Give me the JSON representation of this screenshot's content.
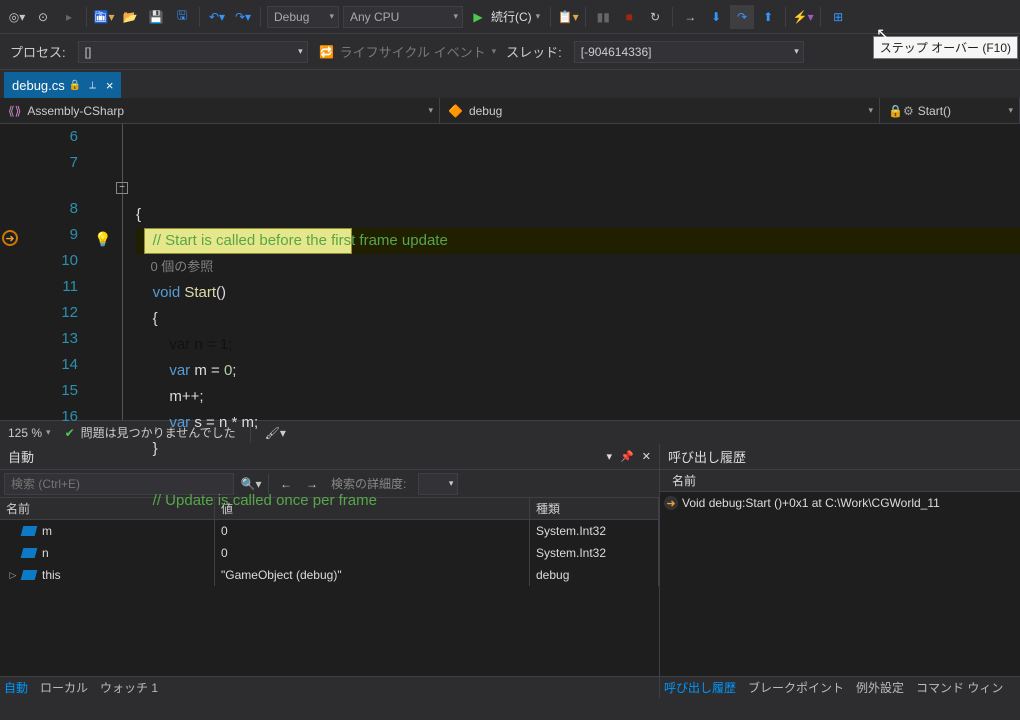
{
  "toolbar": {
    "config_label": "Debug",
    "platform_label": "Any CPU",
    "run_label": "続行(C)"
  },
  "toolbar2": {
    "process_label": "プロセス:",
    "process_value": "[]",
    "lifecycle_label": "ライフサイクル イベント",
    "thread_label": "スレッド:",
    "thread_value": "[-904614336]"
  },
  "tooltip_text": "ステップ オーバー (F10)",
  "tab": {
    "filename": "debug.cs"
  },
  "navbar": {
    "assembly": "Assembly-CSharp",
    "class": "debug",
    "member": "Start()"
  },
  "editor": {
    "line_numbers": [
      "6",
      "7",
      "8",
      "9",
      "10",
      "11",
      "12",
      "13",
      "14",
      "15",
      "16"
    ],
    "lines": {
      "l6": "{",
      "l7": "    // Start is called before the first frame update",
      "l7b": "    0 個の参照",
      "l8a": "    void",
      "l8b": " Start",
      "l8c": "()",
      "l9": "    {",
      "l10a": "        var",
      "l10b": " n = ",
      "l10c": "1",
      "l10d": ";",
      "l11a": "        var",
      "l11b": " m = ",
      "l11c": "0",
      "l11d": ";",
      "l12": "        m++;",
      "l13a": "        var",
      "l13b": " s = n * m;",
      "l14": "    }",
      "l16": "    // Update is called once per frame"
    }
  },
  "status": {
    "zoom": "125 %",
    "issues": "問題は見つかりませんでした"
  },
  "autos": {
    "title": "自動",
    "search_placeholder": "検索 (Ctrl+E)",
    "search_depth_label": "検索の詳細度:",
    "columns": {
      "name": "名前",
      "value": "値",
      "type": "種類"
    },
    "rows": [
      {
        "name": "m",
        "value": "0",
        "type": "System.Int32"
      },
      {
        "name": "n",
        "value": "0",
        "type": "System.Int32"
      },
      {
        "name": "this",
        "value": "\"GameObject (debug)\"",
        "type": "debug"
      }
    ],
    "tabs": {
      "auto": "自動",
      "local": "ローカル",
      "watch": "ウォッチ 1"
    }
  },
  "callstack": {
    "title": "呼び出し履歴",
    "col_name": "名前",
    "frame0": "Void debug:Start ()+0x1 at C:\\Work\\CGWorld_11",
    "tabs": {
      "callstack": "呼び出し履歴",
      "breakpoints": "ブレークポイント",
      "exception": "例外設定",
      "command": "コマンド ウィン"
    }
  }
}
